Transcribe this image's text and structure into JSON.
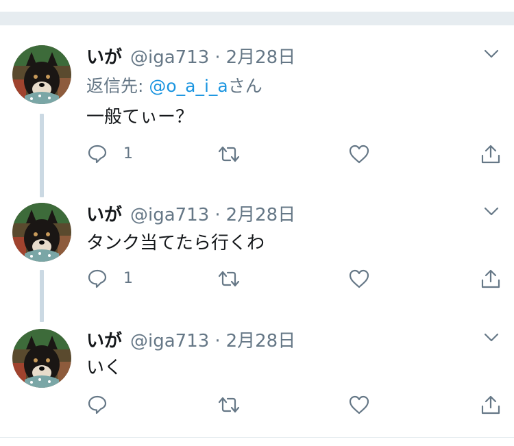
{
  "tweets": [
    {
      "name": "いが",
      "handle": "@iga713",
      "separator": "·",
      "date": "2月28日",
      "reply_prefix": "返信先: ",
      "reply_mention": "@o_a_i_a",
      "reply_suffix": "さん",
      "text": "一般てぃー？",
      "reply_count": "1"
    },
    {
      "name": "いが",
      "handle": "@iga713",
      "separator": "·",
      "date": "2月28日",
      "text": "タンク当てたら行くわ",
      "reply_count": "1"
    },
    {
      "name": "いが",
      "handle": "@iga713",
      "separator": "·",
      "date": "2月28日",
      "text": "いく",
      "reply_count": ""
    }
  ],
  "icons": {
    "menu": "chevron-down-icon",
    "reply": "reply-icon",
    "retweet": "retweet-icon",
    "like": "like-icon",
    "share": "share-icon",
    "avatar": "avatar"
  },
  "colors": {
    "text": "#14171a",
    "muted": "#657786",
    "link": "#1b95e0",
    "thread_line": "#cbd9e3",
    "divider": "#e6ecf0"
  }
}
